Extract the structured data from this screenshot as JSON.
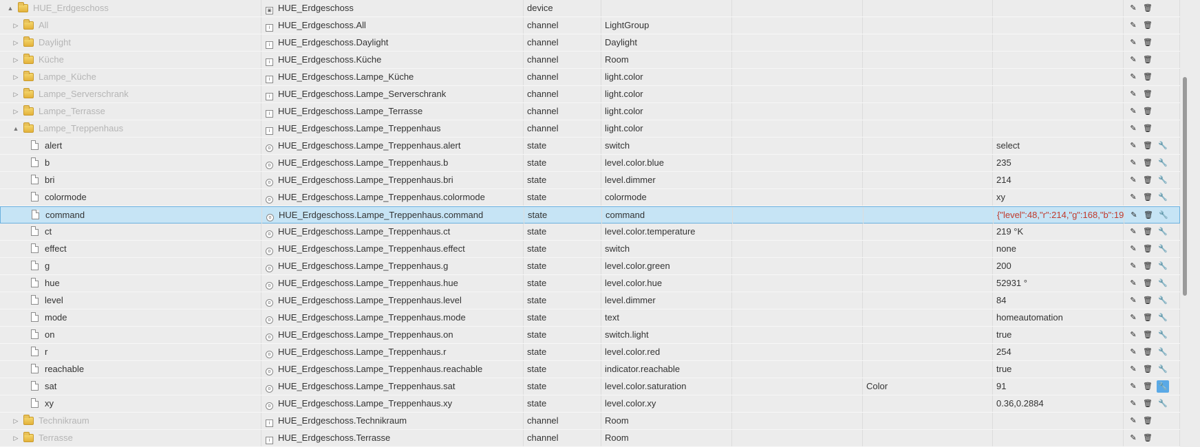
{
  "rows": [
    {
      "depth": 0,
      "kind": "folder",
      "expanded": "▲",
      "name": "HUE_Erdgeschoss",
      "id": "HUE_Erdgeschoss",
      "type": "device",
      "role": "",
      "room": "",
      "func": "",
      "value": "",
      "idicon": "▣",
      "wrench": false
    },
    {
      "depth": 1,
      "kind": "folder",
      "expanded": "▷",
      "name": "All",
      "id": "HUE_Erdgeschoss.All",
      "type": "channel",
      "role": "LightGroup",
      "room": "",
      "func": "",
      "value": "",
      "idicon": "i",
      "wrench": false
    },
    {
      "depth": 1,
      "kind": "folder",
      "expanded": "▷",
      "name": "Daylight",
      "id": "HUE_Erdgeschoss.Daylight",
      "type": "channel",
      "role": "Daylight",
      "room": "",
      "func": "",
      "value": "",
      "idicon": "i",
      "wrench": false
    },
    {
      "depth": 1,
      "kind": "folder",
      "expanded": "▷",
      "name": "Küche",
      "id": "HUE_Erdgeschoss.Küche",
      "type": "channel",
      "role": "Room",
      "room": "",
      "func": "",
      "value": "",
      "idicon": "i",
      "wrench": false
    },
    {
      "depth": 1,
      "kind": "folder",
      "expanded": "▷",
      "name": "Lampe_Küche",
      "id": "HUE_Erdgeschoss.Lampe_Küche",
      "type": "channel",
      "role": "light.color",
      "room": "",
      "func": "",
      "value": "",
      "idicon": "i",
      "wrench": false
    },
    {
      "depth": 1,
      "kind": "folder",
      "expanded": "▷",
      "name": "Lampe_Serverschrank",
      "id": "HUE_Erdgeschoss.Lampe_Serverschrank",
      "type": "channel",
      "role": "light.color",
      "room": "",
      "func": "",
      "value": "",
      "idicon": "i",
      "wrench": false
    },
    {
      "depth": 1,
      "kind": "folder",
      "expanded": "▷",
      "name": "Lampe_Terrasse",
      "id": "HUE_Erdgeschoss.Lampe_Terrasse",
      "type": "channel",
      "role": "light.color",
      "room": "",
      "func": "",
      "value": "",
      "idicon": "i",
      "wrench": false
    },
    {
      "depth": 1,
      "kind": "folder",
      "expanded": "▲",
      "name": "Lampe_Treppenhaus",
      "id": "HUE_Erdgeschoss.Lampe_Treppenhaus",
      "type": "channel",
      "role": "light.color",
      "room": "",
      "func": "",
      "value": "",
      "idicon": "i",
      "wrench": false
    },
    {
      "depth": 2,
      "kind": "file",
      "name": "alert",
      "id": "HUE_Erdgeschoss.Lampe_Treppenhaus.alert",
      "type": "state",
      "role": "switch",
      "room": "",
      "func": "",
      "value": "select",
      "idicon": "o",
      "wrench": true
    },
    {
      "depth": 2,
      "kind": "file",
      "name": "b",
      "id": "HUE_Erdgeschoss.Lampe_Treppenhaus.b",
      "type": "state",
      "role": "level.color.blue",
      "room": "",
      "func": "",
      "value": "235",
      "idicon": "o",
      "wrench": true
    },
    {
      "depth": 2,
      "kind": "file",
      "name": "bri",
      "id": "HUE_Erdgeschoss.Lampe_Treppenhaus.bri",
      "type": "state",
      "role": "level.dimmer",
      "room": "",
      "func": "",
      "value": "214",
      "idicon": "o",
      "wrench": true
    },
    {
      "depth": 2,
      "kind": "file",
      "name": "colormode",
      "id": "HUE_Erdgeschoss.Lampe_Treppenhaus.colormode",
      "type": "state",
      "role": "colormode",
      "room": "",
      "func": "",
      "value": "xy",
      "idicon": "o",
      "wrench": true
    },
    {
      "depth": 2,
      "kind": "file",
      "name": "command",
      "id": "HUE_Erdgeschoss.Lampe_Treppenhaus.command",
      "type": "state",
      "role": "command",
      "room": "",
      "func": "",
      "value": "{\"level\":48,\"r\":214,\"g\":168,\"b\":19",
      "idicon": "o",
      "wrench": true,
      "selected": true,
      "valred": true
    },
    {
      "depth": 2,
      "kind": "file",
      "name": "ct",
      "id": "HUE_Erdgeschoss.Lampe_Treppenhaus.ct",
      "type": "state",
      "role": "level.color.temperature",
      "room": "",
      "func": "",
      "value": "219 °K",
      "idicon": "o",
      "wrench": true
    },
    {
      "depth": 2,
      "kind": "file",
      "name": "effect",
      "id": "HUE_Erdgeschoss.Lampe_Treppenhaus.effect",
      "type": "state",
      "role": "switch",
      "room": "",
      "func": "",
      "value": "none",
      "idicon": "o",
      "wrench": true
    },
    {
      "depth": 2,
      "kind": "file",
      "name": "g",
      "id": "HUE_Erdgeschoss.Lampe_Treppenhaus.g",
      "type": "state",
      "role": "level.color.green",
      "room": "",
      "func": "",
      "value": "200",
      "idicon": "o",
      "wrench": true
    },
    {
      "depth": 2,
      "kind": "file",
      "name": "hue",
      "id": "HUE_Erdgeschoss.Lampe_Treppenhaus.hue",
      "type": "state",
      "role": "level.color.hue",
      "room": "",
      "func": "",
      "value": "52931 °",
      "idicon": "o",
      "wrench": true
    },
    {
      "depth": 2,
      "kind": "file",
      "name": "level",
      "id": "HUE_Erdgeschoss.Lampe_Treppenhaus.level",
      "type": "state",
      "role": "level.dimmer",
      "room": "",
      "func": "",
      "value": "84",
      "idicon": "o",
      "wrench": true
    },
    {
      "depth": 2,
      "kind": "file",
      "name": "mode",
      "id": "HUE_Erdgeschoss.Lampe_Treppenhaus.mode",
      "type": "state",
      "role": "text",
      "room": "",
      "func": "",
      "value": "homeautomation",
      "idicon": "o",
      "wrench": true
    },
    {
      "depth": 2,
      "kind": "file",
      "name": "on",
      "id": "HUE_Erdgeschoss.Lampe_Treppenhaus.on",
      "type": "state",
      "role": "switch.light",
      "room": "",
      "func": "",
      "value": "true",
      "idicon": "o",
      "wrench": true
    },
    {
      "depth": 2,
      "kind": "file",
      "name": "r",
      "id": "HUE_Erdgeschoss.Lampe_Treppenhaus.r",
      "type": "state",
      "role": "level.color.red",
      "room": "",
      "func": "",
      "value": "254",
      "idicon": "o",
      "wrench": true
    },
    {
      "depth": 2,
      "kind": "file",
      "name": "reachable",
      "id": "HUE_Erdgeschoss.Lampe_Treppenhaus.reachable",
      "type": "state",
      "role": "indicator.reachable",
      "room": "",
      "func": "",
      "value": "true",
      "idicon": "o",
      "wrench": true
    },
    {
      "depth": 2,
      "kind": "file",
      "name": "sat",
      "id": "HUE_Erdgeschoss.Lampe_Treppenhaus.sat",
      "type": "state",
      "role": "level.color.saturation",
      "room": "",
      "func": "Color",
      "value": "91",
      "idicon": "o",
      "wrench": true,
      "wrenchActive": true
    },
    {
      "depth": 2,
      "kind": "file",
      "name": "xy",
      "id": "HUE_Erdgeschoss.Lampe_Treppenhaus.xy",
      "type": "state",
      "role": "level.color.xy",
      "room": "",
      "func": "",
      "value": "0.36,0.2884",
      "idicon": "o",
      "wrench": true
    },
    {
      "depth": 1,
      "kind": "folder",
      "expanded": "▷",
      "name": "Technikraum",
      "id": "HUE_Erdgeschoss.Technikraum",
      "type": "channel",
      "role": "Room",
      "room": "",
      "func": "",
      "value": "",
      "idicon": "i",
      "wrench": false
    },
    {
      "depth": 1,
      "kind": "folder",
      "expanded": "▷",
      "name": "Terrasse",
      "id": "HUE_Erdgeschoss.Terrasse",
      "type": "channel",
      "role": "Room",
      "room": "",
      "func": "",
      "value": "",
      "idicon": "i",
      "wrench": false
    }
  ],
  "icons": {
    "edit": "✎",
    "delete": "🗑",
    "wrench": "🔧"
  },
  "colors": {
    "selected_bg": "#c6e4f5",
    "wrench_active": "#5aa9e6",
    "value_red": "#c0392b",
    "folder_text": "#b5b5b5"
  }
}
